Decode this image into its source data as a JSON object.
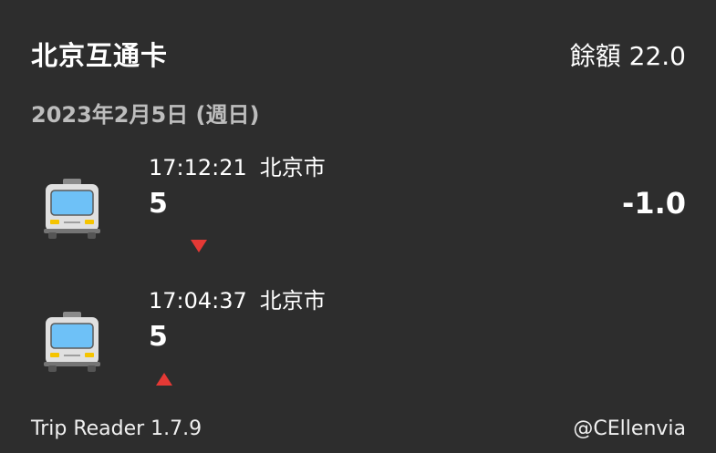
{
  "card": {
    "title": "北京互通卡",
    "balance": "餘額 22.0"
  },
  "date_header": "2023年2月5日 (週日)",
  "trips": [
    {
      "time": "17:12:21",
      "city": "北京市",
      "line": "5",
      "amount": "-1.0",
      "icon": "bus-icon",
      "direction_icon": "arrow-down-icon"
    },
    {
      "time": "17:04:37",
      "city": "北京市",
      "line": "5",
      "amount": "",
      "icon": "bus-icon",
      "direction_icon": "arrow-up-icon"
    }
  ],
  "footer": {
    "app_version": "Trip Reader 1.7.9",
    "author": "@CEllenvia"
  },
  "colors": {
    "background": "#2d2d2d",
    "direction_arrow": "#e53935",
    "bus_window": "#6ec1f7",
    "bus_body": "#e0e0e0"
  }
}
